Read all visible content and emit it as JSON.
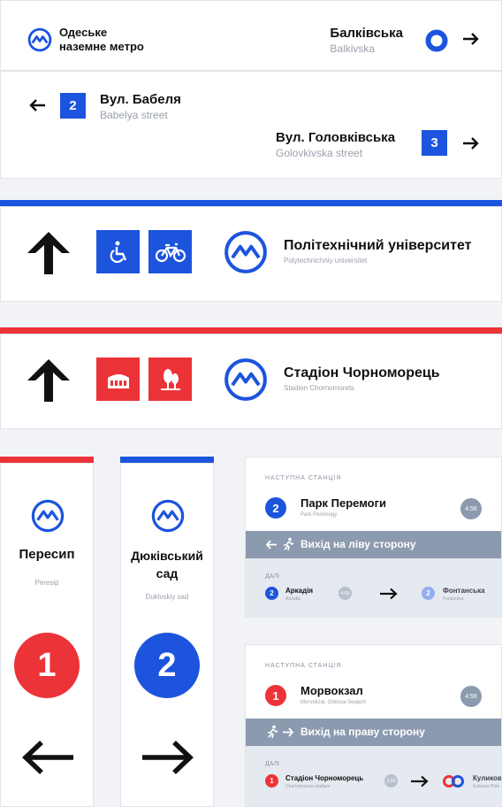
{
  "colors": {
    "blue": "#1c54dd",
    "red": "#ec3338",
    "gray_band": "#8c9aaf",
    "light_panel": "#e5e9f0"
  },
  "sign1": {
    "brand_line1": "Одеське",
    "brand_line2": "наземне метро",
    "station_ua": "Балківська",
    "station_en": "Balkivska"
  },
  "sign2": {
    "left_number": "2",
    "left_ua": "Вул. Бабеля",
    "left_en": "Babelya street",
    "right_number": "3",
    "right_ua": "Вул. Головківська",
    "right_en": "Golovkivska street"
  },
  "sign3": {
    "icons": [
      "wheelchair-icon",
      "bicycle-icon"
    ],
    "station_ua": "Політехнічний університет",
    "station_en": "Polytechnichniy universitet"
  },
  "sign4": {
    "icons": [
      "colosseum-icon",
      "park-trees-icon"
    ],
    "station_ua": "Стадіон Чорноморець",
    "station_en": "Stadion Chornomorets"
  },
  "pillar_left": {
    "title": "Пересип",
    "sub": "Peresip",
    "number": "1"
  },
  "pillar_right": {
    "title_line1": "Дюківський",
    "title_line2": "сад",
    "sub": "Dukivskiy sad",
    "number": "2"
  },
  "screen1": {
    "next_label": "НАСТУПНА СТАНЦІЯ",
    "line_number": "2",
    "station": "Парк Перемоги",
    "station_sub": "Park Peremogy",
    "time": "4:56",
    "exit": "Вихід на ліву сторону",
    "further_label": "ДАЛІ",
    "next1_number": "2",
    "next1": "Аркадія",
    "next1_sub": "Arkadia",
    "next1_time": "4:56",
    "next2_number": "2",
    "next2": "Фонтанська",
    "next2_sub": "Fontanska"
  },
  "screen2": {
    "next_label": "НАСТУПНА СТАНЦІЯ",
    "line_number": "1",
    "station": "Морвокзал",
    "station_sub": "Morvokzal, Odessa Seaport",
    "time": "4:56",
    "exit": "Вихід на праву сторону",
    "further_label": "ДАЛІ",
    "next1_number": "1",
    "next1": "Стадіон Чорноморець",
    "next1_sub": "Chornomorets stadium",
    "next1_time": "3:30",
    "next2": "Куликове",
    "next2_sub": "Kulikovo Pole"
  }
}
